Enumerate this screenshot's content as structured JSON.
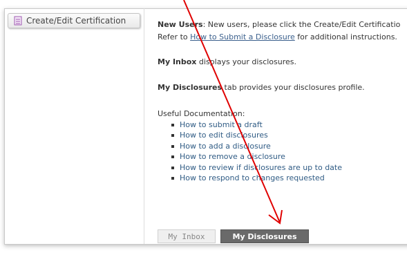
{
  "sidebar": {
    "create_edit_label": "Create/Edit Certification",
    "icon": "document-icon"
  },
  "main": {
    "new_users_bold": "New Users",
    "new_users_text": ":  New users, please click the Create/Edit Certificatio",
    "refer_prefix": "Refer to ",
    "refer_link": "How to Submit a Disclosure",
    "refer_suffix": " for additional instructions.",
    "inbox_bold": "My Inbox",
    "inbox_text": " displays your disclosures.",
    "disclosures_bold": "My Disclosures",
    "disclosures_text": " tab provides your disclosures profile.",
    "useful_docs_label": "Useful Documentation:",
    "docs": [
      "How to submit a draft",
      "How to edit disclosures",
      "How to add a disclosure",
      "How to remove a disclosure",
      "How to review if disclosures are up to date",
      "How to respond to changes requested"
    ]
  },
  "tabs": {
    "inbox": "My Inbox",
    "disclosures": "My Disclosures"
  },
  "colors": {
    "arrow": "#e00000",
    "link": "#3a5f8c",
    "active_tab": "#6a6a6a"
  }
}
